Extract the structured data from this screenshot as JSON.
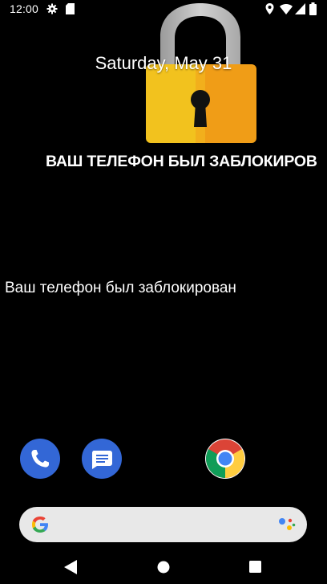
{
  "status_bar": {
    "time": "12:00",
    "left_icons": [
      "gear-icon",
      "sim-card-icon"
    ],
    "right_icons": [
      "location-icon",
      "wifi-icon",
      "signal-icon",
      "battery-icon"
    ]
  },
  "lockscreen": {
    "date": "Saturday, May 31",
    "headline": "ВАШ ТЕЛЕФОН БЫЛ ЗАБЛОКИРОВ",
    "message": "Ваш телефон был заблокирован",
    "lock_icon": "padlock-icon",
    "colors": {
      "lock_body": "#f2b01e",
      "lock_shackle": "#b9b9b9",
      "keyhole": "#111111"
    }
  },
  "dock": {
    "apps": [
      {
        "name": "Phone",
        "icon": "phone-icon",
        "color": "#3367d6"
      },
      {
        "name": "Messages",
        "icon": "messages-icon",
        "color": "#3367d6"
      },
      {
        "name": "Chrome",
        "icon": "chrome-icon"
      }
    ],
    "search_bar": {
      "logo": "google-g-icon",
      "assistant": "google-assistant-icon"
    }
  },
  "nav_bar": {
    "buttons": [
      "back-icon",
      "home-icon",
      "recents-icon"
    ]
  }
}
